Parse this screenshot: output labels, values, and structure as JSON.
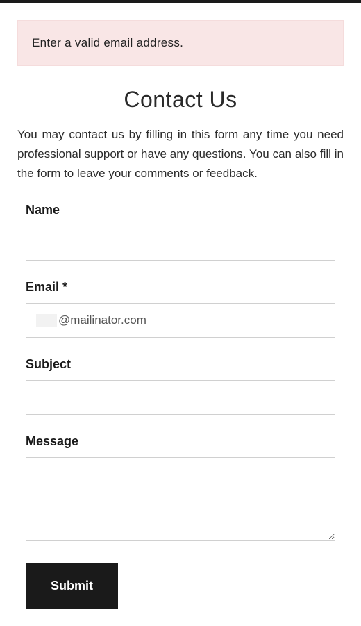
{
  "error": {
    "message": "Enter a valid email address."
  },
  "page": {
    "title": "Contact Us",
    "intro": "You may contact us by filling in this form any time you need professional support or have any questions. You can also fill in the form to leave your comments or feedback."
  },
  "form": {
    "name": {
      "label": "Name",
      "value": ""
    },
    "email": {
      "label": "Email *",
      "value": "@mailinator.com"
    },
    "subject": {
      "label": "Subject",
      "value": ""
    },
    "message": {
      "label": "Message",
      "value": ""
    },
    "submit": {
      "label": "Submit"
    }
  }
}
